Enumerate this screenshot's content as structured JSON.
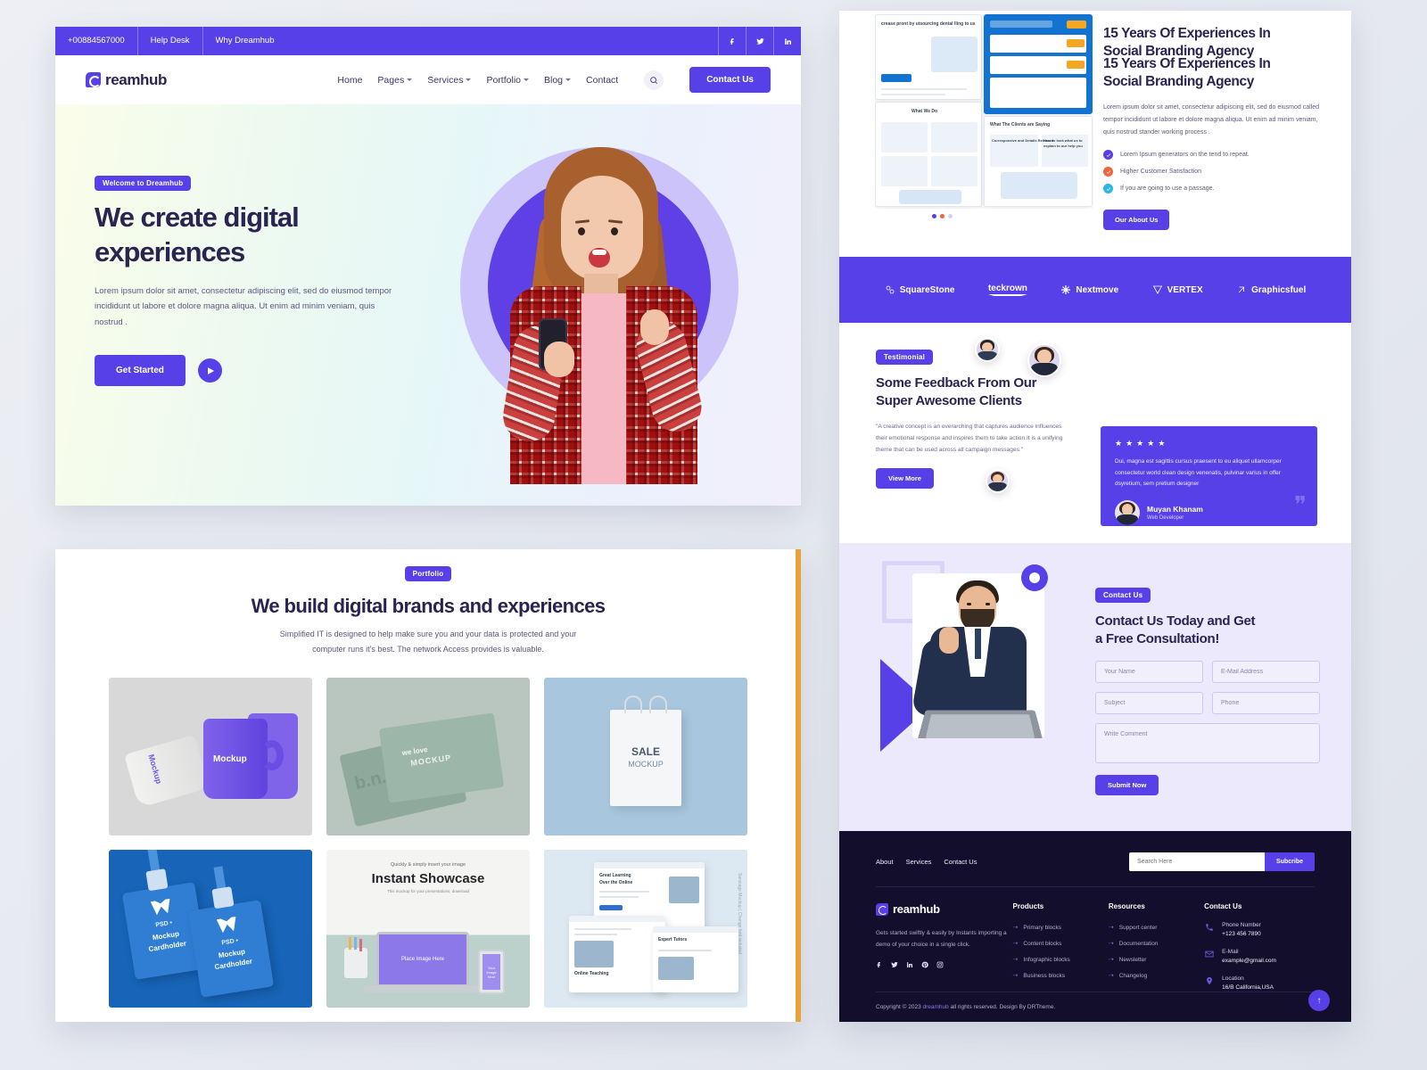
{
  "hero_card": {
    "topbar": {
      "phone": "+00884567000",
      "help": "Help Desk",
      "why": "Why Dreamhub",
      "socials": [
        "facebook-icon",
        "twitter-icon",
        "linkedin-icon"
      ]
    },
    "nav": {
      "logo": "reamhub",
      "items": [
        {
          "label": "Home",
          "caret": false
        },
        {
          "label": "Pages",
          "caret": true
        },
        {
          "label": "Services",
          "caret": true
        },
        {
          "label": "Portfolio",
          "caret": true
        },
        {
          "label": "Blog",
          "caret": true
        },
        {
          "label": "Contact",
          "caret": false
        }
      ],
      "search_icon": "search-icon",
      "cta": "Contact Us"
    },
    "hero": {
      "badge": "Welcome to Dreamhub",
      "title_line1": "We create digital",
      "title_line2": "experiences",
      "body": "Lorem ipsum dolor sit amet, consectetur adipiscing elit, sed do eiusmod tempor incididunt ut labore et dolore magna aliqua. Ut enim ad minim veniam, quis nostrud .",
      "cta": "Get Started",
      "play_icon": "play-icon"
    }
  },
  "portfolio_card": {
    "badge": "Portfolio",
    "title": "We build digital brands and experiences",
    "subtitle_line1": "Simplified IT is designed to help make sure you and your data is protected and your",
    "subtitle_line2": "computer runs it's best. The network Access provides is valuable.",
    "cells": [
      {
        "name": "mug-mockup",
        "label_a": "Mockup",
        "label_b": "Mockup"
      },
      {
        "name": "business-card-mockup",
        "label_a": "we love",
        "label_b": "MOCKUP",
        "label_c": "b.n."
      },
      {
        "name": "shopping-bag-mockup",
        "label_a": "SALE",
        "label_b": "MOCKUP"
      },
      {
        "name": "psd-cardholder-mockup",
        "label_a": "PSD •",
        "label_b": "Mockup",
        "label_c": "Cardholder"
      },
      {
        "name": "desk-showcase-mockup",
        "top": "Quickly & simply insert your image",
        "title": "Instant Showcase",
        "sub": "This mockup for your presentations, download",
        "screen": "Place Image Here",
        "phone": "Your Image Here"
      },
      {
        "name": "website-mockup",
        "title": "Great Learning",
        "sub": "Over the Online",
        "card2": "Online Teaching",
        "card3": "Expert Tutors",
        "side": "Sanxiage Mockup  |  Change font included"
      }
    ]
  },
  "about": {
    "heading_line1": "15 Years Of Experiences In",
    "heading_line2": "Social Branding Agency",
    "body": "Lorem ipsum dolor sit amet, consectetur adipiscing elit, sed do eiusmod called tempor incididunt ut labore et dolore magna aliqua. Ut enim ad minim veniam, quis nostrud stander working process .",
    "bullets": [
      {
        "text": "Lorem Ipsum generators on the tend to repeat.",
        "color": "#5840e8"
      },
      {
        "text": "Higher Customer Satisfaction",
        "color": "#f0663c"
      },
      {
        "text": "If you are going to use a passage.",
        "color": "#2bb8e6"
      }
    ],
    "cta": "Our About Us",
    "mockup_texts": {
      "a": "crease pront by utsourcing dental lling to us",
      "b": "crease pront by utsourcing dental lling to us",
      "c": "What We Do",
      "d": "What The Clients are Saying",
      "e": "Corresponsive and Details Released",
      "f": "How to look what us to explain to our help you"
    },
    "dots": 3
  },
  "brands": [
    {
      "name": "SquareStone",
      "icon": "squarestone-icon"
    },
    {
      "name": "teckrown",
      "icon": "teckrown-icon"
    },
    {
      "name": "Nextmove",
      "icon": "nextmove-icon"
    },
    {
      "name": "VERTEX",
      "icon": "vertex-icon"
    },
    {
      "name": "Graphicsfuel",
      "icon": "graphicsfuel-icon"
    }
  ],
  "testimonial": {
    "badge": "Testimonial",
    "title_line1": "Some Feedback From Our",
    "title_line2": "Super Awesome Clients",
    "body": "\"A creative concept is an overarching that captures audience influences their emotional response and inspires them to take action.It is a unifying theme that can be used across all campaign messages.\"",
    "cta": "View More",
    "card": {
      "stars": 5,
      "quote": "Dui, magna est sagittis cursus praesent to eu aliquet ullamcorper consectetur world clean design venenatis, pulvinar varius in offer dsyretium, sem pretium designer",
      "author": "Muyan Khanam",
      "role": "Web Developer",
      "quote_icon": "quote-icon"
    }
  },
  "contact": {
    "badge": "Contact Us",
    "title_line1": "Contact Us Today and Get",
    "title_line2": "a Free Consultation!",
    "fields": {
      "name": "Your Name",
      "email": "E-Mail Address",
      "subject": "Subject",
      "phone": "Phone",
      "comment": "Write Comment"
    },
    "submit": "Submit Now"
  },
  "footer": {
    "links": [
      "About",
      "Services",
      "Contact Us"
    ],
    "search_placeholder": "Search Here",
    "subscribe": "Subcribe",
    "logo": "reamhub",
    "about": "Gets started swiftly & easily by Instants importing a demo of your choice in a single click.",
    "socials": [
      "facebook-icon",
      "twitter-icon",
      "linkedin-icon",
      "pinterest-icon",
      "instagram-icon"
    ],
    "products": {
      "title": "Products",
      "items": [
        "Primary blocks",
        "Content blocks",
        "Infographic blocks",
        "Business blocks"
      ]
    },
    "resources": {
      "title": "Resources",
      "items": [
        "Support center",
        "Documentation",
        "Newsletter",
        "Changelog"
      ]
    },
    "contact": {
      "title": "Contact Us",
      "items": [
        {
          "icon": "phone-icon",
          "label": "Phone Number",
          "value": "+123 456 7890"
        },
        {
          "icon": "mail-icon",
          "label": "E-Mail",
          "value": "example@gmail.com"
        },
        {
          "icon": "location-icon",
          "label": "Location",
          "value": "16/B California,USA"
        }
      ]
    },
    "copyright_pre": "Copyright © 2023 ",
    "copyright_brand": "dreamhub",
    "copyright_post": " all rights reserved. Design By DRTheme.",
    "to_top_icon": "arrow-up-icon"
  },
  "colors": {
    "primary": "#5840e8",
    "dark": "#2b2350",
    "footer_bg": "#130e2b",
    "contact_bg": "#ece9fd",
    "accent_orange": "#f0663c",
    "accent_cyan": "#2bb8e6"
  }
}
